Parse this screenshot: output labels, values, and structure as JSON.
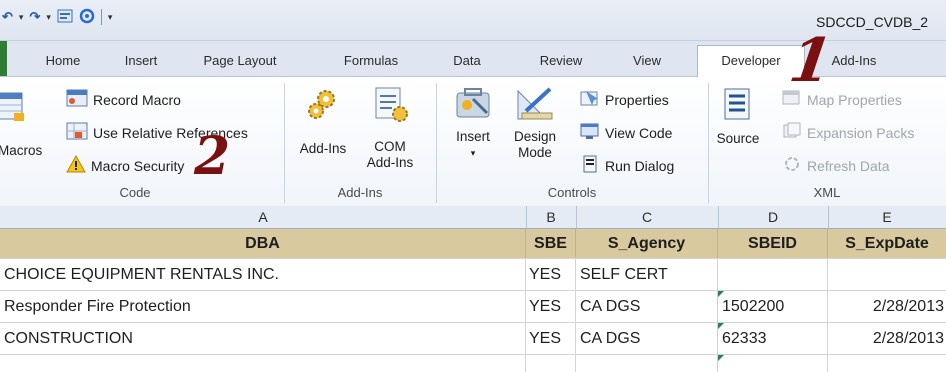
{
  "window": {
    "title": "SDCCD_CVDB_2"
  },
  "tabs": [
    "Home",
    "Insert",
    "Page Layout",
    "Formulas",
    "Data",
    "Review",
    "View",
    "Developer",
    "Add-Ins"
  ],
  "groups": {
    "code": {
      "label": "Code",
      "macros_label": "Macros",
      "record_macro": "Record Macro",
      "use_relative": "Use Relative References",
      "macro_security": "Macro Security"
    },
    "addins": {
      "label": "Add-Ins",
      "addins_label": "Add-Ins",
      "com_line1": "COM",
      "com_line2": "Add-Ins"
    },
    "controls": {
      "label": "Controls",
      "insert": "Insert",
      "design_line1": "Design",
      "design_line2": "Mode",
      "properties": "Properties",
      "view_code": "View Code",
      "run_dialog": "Run Dialog"
    },
    "xml": {
      "label": "XML",
      "source": "Source",
      "map_properties": "Map Properties",
      "expansion_packs": "Expansion Packs",
      "refresh_data": "Refresh Data"
    }
  },
  "annotations": {
    "one": "1",
    "two": "2"
  },
  "colors": {
    "annotation": "#7a1010",
    "header_fill": "#d8c99e",
    "active_tab": "#ffffff"
  },
  "sheet": {
    "column_letters": [
      "A",
      "B",
      "C",
      "D",
      "E"
    ],
    "headers": [
      "DBA",
      "SBE",
      "S_Agency",
      "SBEID",
      "S_ExpDate"
    ],
    "rows": [
      [
        "CHOICE EQUIPMENT RENTALS INC.",
        "YES",
        "SELF CERT",
        "",
        ""
      ],
      [
        "Responder Fire Protection",
        "YES",
        "CA DGS",
        "1502200",
        "2/28/2013"
      ],
      [
        "CONSTRUCTION",
        "YES",
        "CA DGS",
        "62333",
        "2/28/2013"
      ]
    ]
  }
}
